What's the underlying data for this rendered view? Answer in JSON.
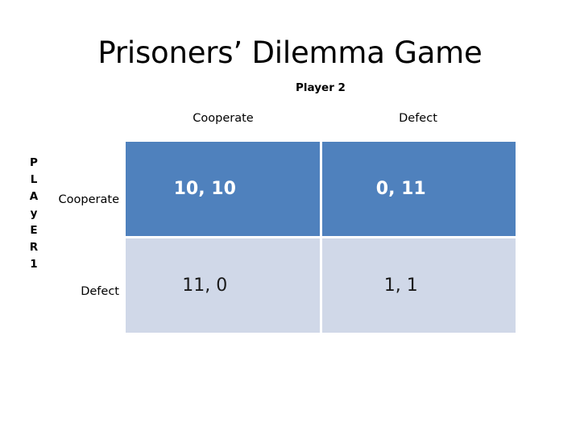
{
  "slide": {
    "title": "Prisoners’ Dilemma Game",
    "background_color": "#ffffff"
  },
  "matrix": {
    "column_axis_title": "Player 2",
    "row_axis_title_letters": [
      "P",
      "L",
      "A",
      "y",
      "E",
      "R",
      "1"
    ],
    "column_headers": [
      "Cooperate",
      "Defect"
    ],
    "row_headers": [
      "Cooperate",
      "Defect"
    ],
    "colors": {
      "highlight_cell": "#4f81bd",
      "highlight_text": "#ffffff",
      "normal_cell": "#d0d8e8",
      "normal_text": "#1a1a1a",
      "gridline": "#ffffff"
    },
    "rows": [
      {
        "header": "Cooperate",
        "cells": [
          {
            "payoff": "10, 10",
            "style": "highlight"
          },
          {
            "payoff": "0, 11",
            "style": "highlight"
          }
        ]
      },
      {
        "header": "Defect",
        "cells": [
          {
            "payoff": "11, 0",
            "style": "normal"
          },
          {
            "payoff": "1, 1",
            "style": "normal"
          }
        ]
      }
    ]
  }
}
